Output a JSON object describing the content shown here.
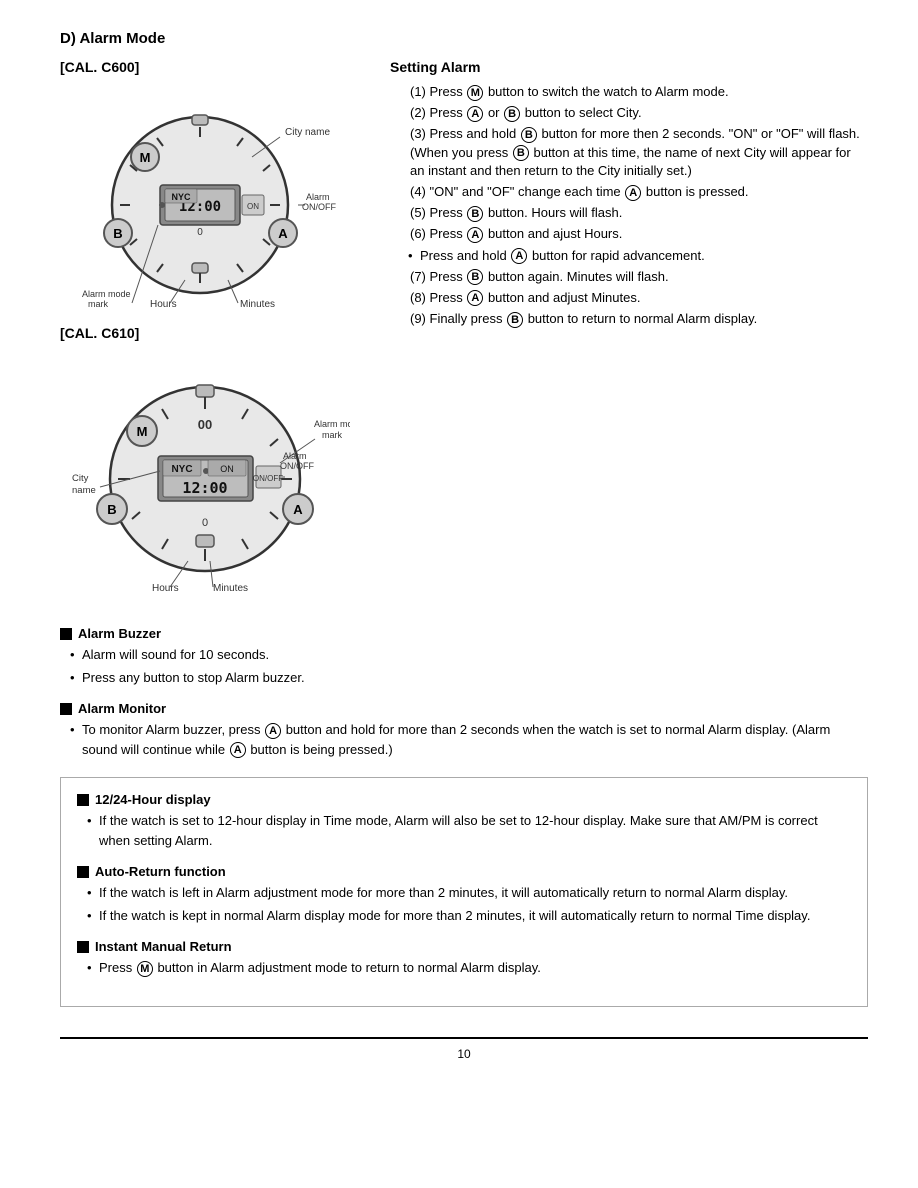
{
  "page": {
    "section_d_title": "D)  Alarm Mode",
    "cal_c600_label": "[CAL. C600]",
    "cal_c610_label": "[CAL. C610]",
    "setting_alarm_title": "Setting Alarm",
    "steps": [
      {
        "num": "(1)",
        "text": "Press ",
        "btn": "M",
        "text2": " button to switch the watch to Alarm mode."
      },
      {
        "num": "(2)",
        "text": "Press ",
        "btn": "A",
        "text2": " or ",
        "btn2": "B",
        "text3": " button to select City."
      },
      {
        "num": "(3)",
        "text": "Press and hold ",
        "btn": "B",
        "text2": " button for more then 2 seconds. \"ON\" or \"OF\" will flash. (When you press ",
        "btn2": "B",
        "text3": " button at this time, the name of next City will appear for an instant and then return to the City initially set.)"
      },
      {
        "num": "(4)",
        "text": "\"ON\" and \"OF\" change each time ",
        "btn": "A",
        "text2": " button is pressed."
      },
      {
        "num": "(5)",
        "text": "Press ",
        "btn": "B",
        "text2": " button. Hours will flash."
      },
      {
        "num": "(6)",
        "text": "Press ",
        "btn": "A",
        "text2": " button and ajust Hours."
      },
      {
        "num": "bullet",
        "text": "Press and hold ",
        "btn": "A",
        "text2": " button for rapid advancement."
      },
      {
        "num": "(7)",
        "text": "Press ",
        "btn": "B",
        "text2": " button again. Minutes will flash."
      },
      {
        "num": "(8)",
        "text": "Press ",
        "btn": "A",
        "text2": " button and adjust Minutes."
      },
      {
        "num": "(9)",
        "text": "Finally press ",
        "btn": "B",
        "text2": " button to return to normal Alarm display."
      }
    ],
    "alarm_buzzer_title": "Alarm Buzzer",
    "alarm_buzzer_bullets": [
      "Alarm will sound for 10 seconds.",
      "Press any button to stop Alarm buzzer."
    ],
    "alarm_monitor_title": "Alarm Monitor",
    "alarm_monitor_bullets": [
      "To monitor Alarm buzzer, press  button and hold for more than 2 seconds when the watch is set to normal Alarm display. (Alarm sound will continue while  button is being pressed.)"
    ],
    "alarm_monitor_btn1": "A",
    "alarm_monitor_btn2": "A",
    "infobox": {
      "hour_display_title": "12/24-Hour display",
      "hour_display_text": "If the watch is set to 12-hour display in Time mode, Alarm will also be set to 12-hour display. Make sure that AM/PM is correct when setting Alarm.",
      "auto_return_title": "Auto-Return function",
      "auto_return_bullets": [
        "If the watch is left in Alarm adjustment mode for more than 2 minutes, it will automatically return to normal Alarm display.",
        "If the watch is kept in normal Alarm display mode for more than 2 minutes, it will automatically return to normal Time display."
      ],
      "instant_manual_title": "Instant Manual Return",
      "instant_manual_text": "Press  button in Alarm adjustment mode to return to normal Alarm display.",
      "instant_manual_btn": "M"
    },
    "page_number": "10",
    "c600_labels": {
      "city_name": "City name",
      "alarm_mode_mark": "Alarm mode mark",
      "alarm_on_off": "Alarm ON/OFF",
      "hours": "Hours",
      "minutes": "Minutes",
      "display": "12:00"
    },
    "c610_labels": {
      "city_name": "City name",
      "alarm_mode_mark": "Alarm mode mark",
      "alarm_on_off": "Alarm ON/OFF",
      "hours": "Hours",
      "minutes": "Minutes",
      "display": "12:00"
    }
  }
}
